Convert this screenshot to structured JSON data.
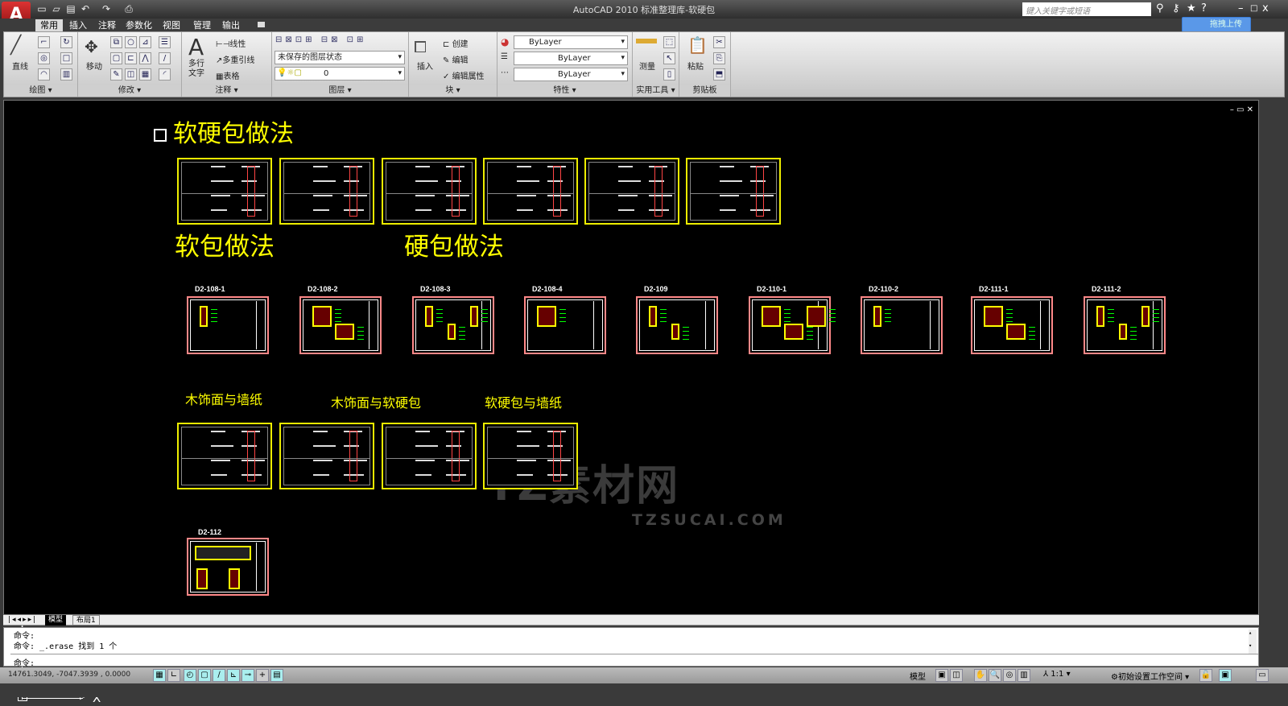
{
  "titlebar": {
    "title": "AutoCAD 2010    标准整理库-软硬包",
    "search_placeholder": "键入关键字或短语",
    "upload_label": "拖拽上传"
  },
  "quick_access": [
    "new-icon",
    "open-icon",
    "save-icon",
    "undo-icon",
    "redo-icon",
    "plot-icon"
  ],
  "tabs": [
    {
      "label": "常用",
      "active": true
    },
    {
      "label": "插入"
    },
    {
      "label": "注释"
    },
    {
      "label": "参数化"
    },
    {
      "label": "视图"
    },
    {
      "label": "管理"
    },
    {
      "label": "输出"
    }
  ],
  "ribbon": {
    "panels": [
      {
        "label": "绘图 ▾"
      },
      {
        "label": "修改 ▾"
      },
      {
        "label": "注释 ▾"
      },
      {
        "label": "图层 ▾"
      },
      {
        "label": "块 ▾"
      },
      {
        "label": "特性 ▾"
      },
      {
        "label": "实用工具 ▾"
      },
      {
        "label": "剪贴板"
      }
    ],
    "draw": {
      "line": "直线"
    },
    "modify": {
      "move": "移动"
    },
    "annotation": {
      "mtext": "多行\n文字",
      "linear": "线性",
      "mleader": "多重引线",
      "table": "表格"
    },
    "layers": {
      "state": "未保存的图层状态",
      "current": "0"
    },
    "block": {
      "insert": "插入",
      "create": "创建",
      "edit": "编辑",
      "attr": "编辑属性"
    },
    "properties": {
      "color": "ByLayer",
      "linetype": "ByLayer",
      "lineweight": "ByLayer"
    },
    "utilities": {
      "measure": "测量"
    },
    "clipboard": {
      "paste": "粘贴"
    }
  },
  "drawing": {
    "heading": "软硬包做法",
    "soft_label": "软包做法",
    "hard_label": "硬包做法",
    "sheets_row2": [
      "D2-108-1",
      "D2-108-2",
      "D2-108-3",
      "D2-108-4",
      "D2-109",
      "D2-110-1",
      "D2-110-2",
      "D2-111-1",
      "D2-111-2"
    ],
    "row3_labels": [
      "木饰面与墙纸",
      "木饰面与软硬包",
      "软硬包与墙纸"
    ],
    "sheet_row4": "D2-112",
    "ucs": {
      "y": "Y",
      "x": "X"
    },
    "watermark": "TZ素材网",
    "watermark_url": "TZSUCAI.COM",
    "colors": {
      "text": "#ffff00",
      "sheet_border": "#ff8888",
      "background": "#000000"
    }
  },
  "layout_tabs": [
    {
      "label": "模型",
      "active": true
    },
    {
      "label": "布局1"
    }
  ],
  "command": {
    "history": [
      "命令:",
      "命令: _.erase 找到 1 个"
    ],
    "prompt": "命令:"
  },
  "status": {
    "coords": "14761.3049, -7047.3939 , 0.0000",
    "model": "模型",
    "annotation_scale": "1:1",
    "workspace": "初始设置工作空间"
  }
}
